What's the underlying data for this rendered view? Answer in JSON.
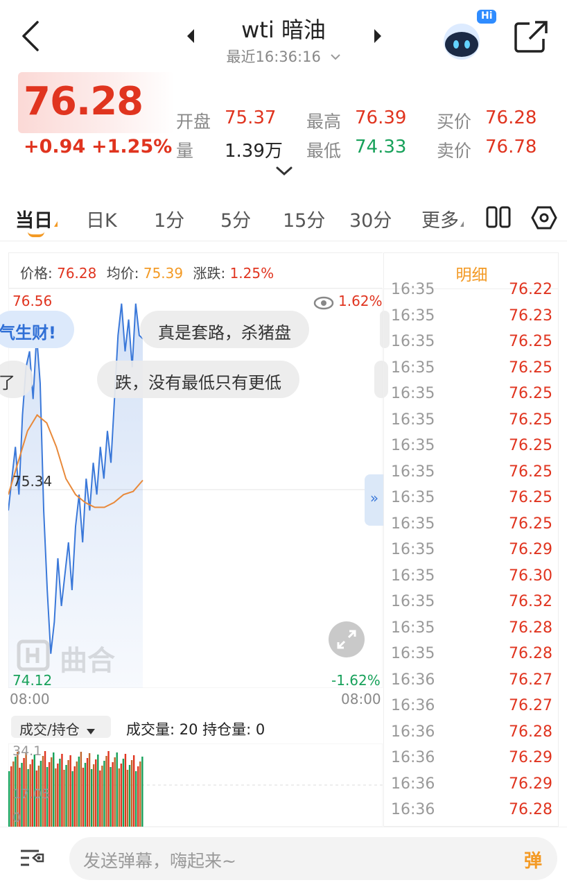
{
  "header": {
    "title": "wti 暗油",
    "subtitle": "最近16:36:16",
    "chat_badge": "Hi"
  },
  "quote": {
    "price": "76.28",
    "change": "+0.94",
    "change_pct": "+1.25%",
    "open_label": "开盘",
    "open": "75.37",
    "high_label": "最高",
    "high": "76.39",
    "bid_label": "买价",
    "bid": "76.28",
    "vol_label": "量",
    "volume": "1.39万",
    "low_label": "最低",
    "low": "74.33",
    "ask_label": "卖价",
    "ask": "76.78"
  },
  "tabs": [
    "当日",
    "日K",
    "1分",
    "5分",
    "15分",
    "30分",
    "更多"
  ],
  "chart_info": {
    "price_label": "价格:",
    "price": "76.28",
    "avg_label": "均价:",
    "avg": "75.39",
    "chg_label": "涨跌:",
    "chg": "1.25%"
  },
  "chart_labels": {
    "y_max": "76.56",
    "y_min": "74.12",
    "y_mid": "75.34",
    "pct_max": "1.62%",
    "pct_min": "-1.62%",
    "x_start": "08:00",
    "x_end": "08:00",
    "watermark": "曲合"
  },
  "danmu": [
    "气生财!",
    "真是套路，杀猪盘",
    "了",
    "跌，没有最低只有更低"
  ],
  "ticks": {
    "title": "明细",
    "rows": [
      {
        "time": "16:35",
        "price": "76.22"
      },
      {
        "time": "16:35",
        "price": "76.23"
      },
      {
        "time": "16:35",
        "price": "76.25"
      },
      {
        "time": "16:35",
        "price": "76.25"
      },
      {
        "time": "16:35",
        "price": "76.25"
      },
      {
        "time": "16:35",
        "price": "76.25"
      },
      {
        "time": "16:35",
        "price": "76.25"
      },
      {
        "time": "16:35",
        "price": "76.25"
      },
      {
        "time": "16:35",
        "price": "76.25"
      },
      {
        "time": "16:35",
        "price": "76.25"
      },
      {
        "time": "16:35",
        "price": "76.29"
      },
      {
        "time": "16:35",
        "price": "76.30"
      },
      {
        "time": "16:35",
        "price": "76.32"
      },
      {
        "time": "16:35",
        "price": "76.28"
      },
      {
        "time": "16:35",
        "price": "76.28"
      },
      {
        "time": "16:36",
        "price": "76.27"
      },
      {
        "time": "16:36",
        "price": "76.27"
      },
      {
        "time": "16:36",
        "price": "76.28"
      },
      {
        "time": "16:36",
        "price": "76.29"
      },
      {
        "time": "16:36",
        "price": "76.29"
      },
      {
        "time": "16:36",
        "price": "76.28"
      }
    ]
  },
  "volume": {
    "selector": "成交/持仓",
    "info": "成交量: 20 持仓量: 0",
    "y_max": "34.1",
    "y_mid": "17.05",
    "y_min": "0"
  },
  "bottom": {
    "placeholder": "发送弹幕，嗨起来~",
    "send": "弹"
  },
  "colors": {
    "up": "#e0341f",
    "down": "#17a15a",
    "accent": "#f39a25",
    "line": "#3a78d9",
    "avg": "#e8893a"
  },
  "chart_data": {
    "type": "line",
    "ylim": [
      74.12,
      76.56
    ],
    "series": [
      {
        "values": [
          75.2,
          75.4,
          75.6,
          75.3,
          75.8,
          76.1,
          76.2,
          75.9,
          76.3,
          76.0,
          75.2,
          74.7,
          74.3,
          74.5,
          74.9,
          74.6,
          74.8,
          75.0,
          74.7,
          75.1,
          75.3,
          75.0,
          75.4,
          75.2,
          75.5,
          75.3,
          75.6,
          75.4,
          75.7,
          75.5,
          75.9,
          76.3,
          76.5,
          76.2,
          76.4,
          76.1,
          76.5,
          76.3,
          76.28
        ]
      },
      {
        "values": [
          75.3,
          75.5,
          75.7,
          75.8,
          75.75,
          75.6,
          75.4,
          75.3,
          75.25,
          75.22,
          75.22,
          75.25,
          75.3,
          75.32,
          75.39
        ]
      }
    ]
  }
}
